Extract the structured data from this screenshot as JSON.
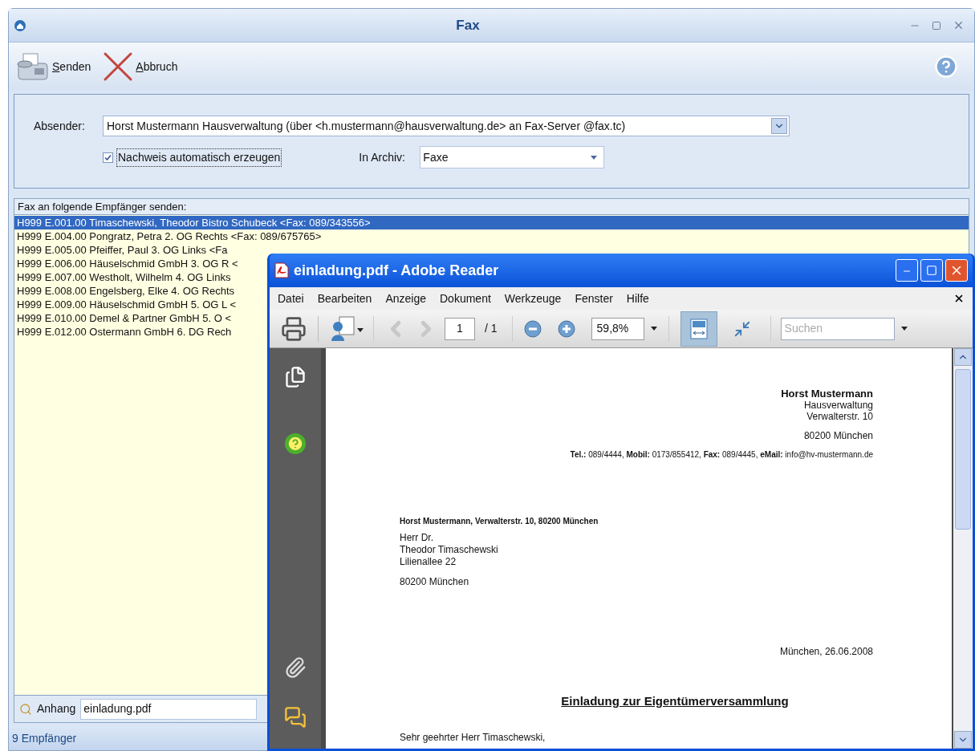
{
  "window": {
    "title": "Fax"
  },
  "toolbar": [
    {
      "kind": "send",
      "label": "Senden"
    },
    {
      "kind": "cancel",
      "label": "Abbruch"
    }
  ],
  "sender": {
    "label": "Absender:",
    "value": "Horst Mustermann Hausverwaltung (über <h.mustermann@hausverwaltung.de> an Fax-Server @fax.tc)"
  },
  "proof": {
    "label": "Nachweis automatisch erzeugen",
    "checked": true
  },
  "archive": {
    "label": "In Archiv:",
    "value": "Faxe"
  },
  "recipients": {
    "header": "Fax an folgende Empfänger senden:",
    "rows": [
      {
        "text": "H999 E.001.00 Timaschewski, Theodor Bistro Schubeck <Fax: 089/343556>",
        "selected": true
      },
      {
        "text": "H999 E.004.00 Pongratz, Petra 2. OG Rechts <Fax: 089/675765>",
        "selected": false
      },
      {
        "text": "H999 E.005.00 Pfeiffer, Paul 3. OG Links <Fa",
        "selected": false
      },
      {
        "text": "H999 E.006.00 Häuselschmid GmbH 3. OG R <",
        "selected": false
      },
      {
        "text": "H999 E.007.00 Westholt, Wilhelm 4. OG Links",
        "selected": false
      },
      {
        "text": "H999 E.008.00 Engelsberg, Elke 4. OG Rechts",
        "selected": false
      },
      {
        "text": "H999 E.009.00 Häuselschmid GmbH 5. OG L <",
        "selected": false
      },
      {
        "text": "H999 E.010.00 Demel & Partner GmbH 5. O <",
        "selected": false
      },
      {
        "text": "H999 E.012.00 Ostermann GmbH 6. DG Rech",
        "selected": false
      }
    ]
  },
  "attachment": {
    "label": "Anhang",
    "value": "einladung.pdf"
  },
  "status_bar": "9 Empfänger",
  "reader": {
    "title": "einladung.pdf - Adobe Reader",
    "menu": [
      "Datei",
      "Bearbeiten",
      "Anzeige",
      "Dokument",
      "Werkzeuge",
      "Fenster",
      "Hilfe"
    ],
    "page_number": "1",
    "page_total": "/ 1",
    "zoom": "59,8%",
    "view_tools": [
      {
        "kind": "fit_width",
        "selected": true
      },
      {
        "kind": "fit_page",
        "selected": false
      }
    ],
    "search_placeholder": "Suchen",
    "document": {
      "sender_name": "Horst Mustermann",
      "sender_lines": [
        "Hausverwaltung",
        "Verwalterstr. 10"
      ],
      "sender_city": "80200 München",
      "contact": "**Tel.:** 089/4444, **Mobil:** 0173/855412, **Fax:** 089/4445, **eMail:** info@hv-mustermann.de",
      "return_address": "Horst Mustermann, Verwalterstr. 10, 80200 München",
      "recipient_lines": [
        "Herr Dr.",
        "Theodor Timaschewski",
        "Lilienallee 22"
      ],
      "recipient_city": "80200 München",
      "date": "München, 26.06.2008",
      "subject": "Einladung zur Eigentümerversammlung",
      "salutation": "Sehr geehrter Herr Timaschewski,"
    }
  }
}
